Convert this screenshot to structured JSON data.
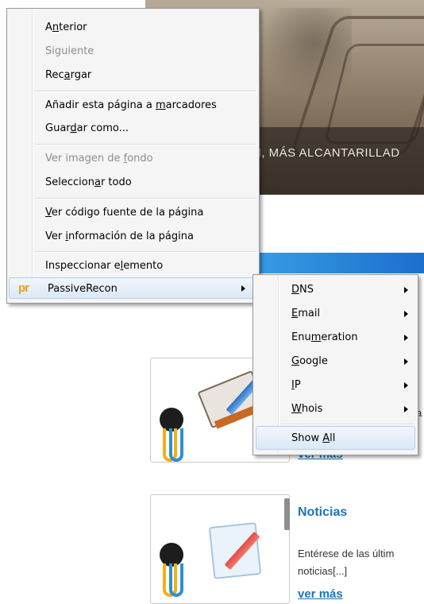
{
  "background_page": {
    "banner_text": "N, MÁS ALCANTARILLAD",
    "card1": {
      "link": "ver más",
      "side_fragment": "a"
    },
    "card2": {
      "title": "Noticias",
      "body_line1": "Entérese de las últim",
      "body_line2": "noticias[...]",
      "link": "ver más"
    }
  },
  "context_menu": {
    "items": [
      {
        "pre": "A",
        "key": "n",
        "post": "terior",
        "disabled": false
      },
      {
        "pre": "Siguiente",
        "key": "",
        "post": "",
        "disabled": true
      },
      {
        "pre": "Rec",
        "key": "a",
        "post": "rgar",
        "disabled": false
      },
      {
        "pre": "Añadir esta página a ",
        "key": "m",
        "post": "arcadores",
        "disabled": false
      },
      {
        "pre": "Guar",
        "key": "d",
        "post": "ar como...",
        "disabled": false
      },
      {
        "pre": "Ver imagen de ",
        "key": "f",
        "post": "ondo",
        "disabled": true
      },
      {
        "pre": "Seleccion",
        "key": "a",
        "post": "r todo",
        "disabled": false
      },
      {
        "pre": "",
        "key": "V",
        "post": "er código fuente de la página",
        "disabled": false
      },
      {
        "pre": "Ver ",
        "key": "i",
        "post": "nformación de la página",
        "disabled": false
      },
      {
        "pre": "Inspeccionar e",
        "key": "l",
        "post": "emento",
        "disabled": false
      }
    ],
    "plugin": {
      "icon_text": "pr",
      "label": "PassiveRecon"
    }
  },
  "submenu": {
    "items": [
      {
        "pre": "",
        "key": "D",
        "post": "NS"
      },
      {
        "pre": "",
        "key": "E",
        "post": "mail"
      },
      {
        "pre": "Enu",
        "key": "m",
        "post": "eration"
      },
      {
        "pre": "",
        "key": "G",
        "post": "oogle"
      },
      {
        "pre": "",
        "key": "I",
        "post": "P"
      },
      {
        "pre": "",
        "key": "W",
        "post": "hois"
      }
    ],
    "show_all": {
      "pre": "Show ",
      "key": "A",
      "post": "ll"
    }
  },
  "colors": {
    "link": "#1d73b8",
    "menu_bg": "#f5f5f5",
    "highlight": "#dbe8f7",
    "plugin_icon": "#e8a11a"
  }
}
